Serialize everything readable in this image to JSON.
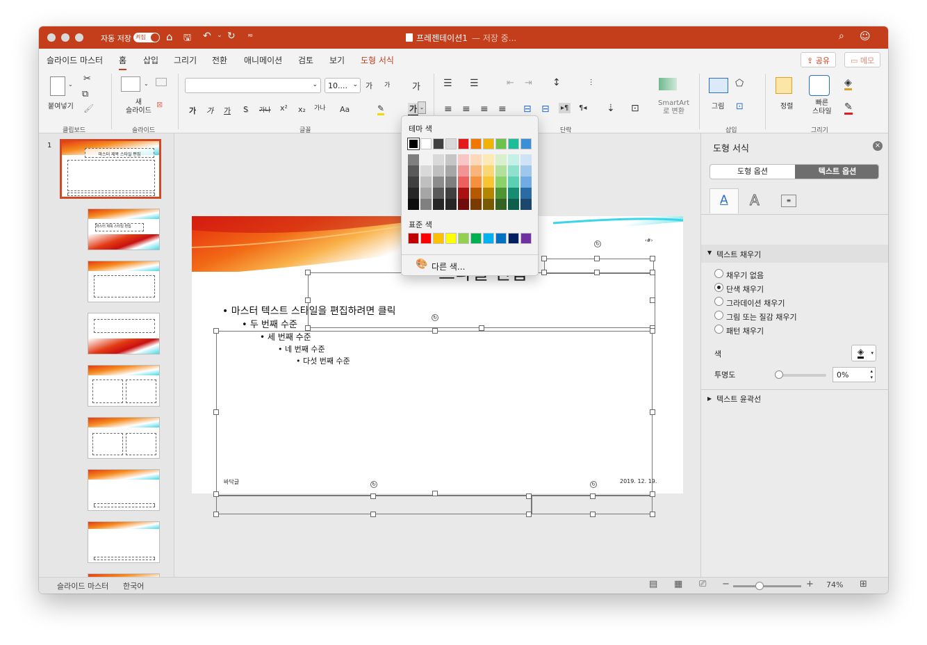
{
  "titlebar": {
    "autosave_label": "자동 저장",
    "autosave_toggle": "켜짐",
    "doc_title": "프레젠테이션1",
    "save_status": " — 저장 중..."
  },
  "tabs": [
    {
      "label": "슬라이드 마스터"
    },
    {
      "label": "홈"
    },
    {
      "label": "삽입"
    },
    {
      "label": "그리기"
    },
    {
      "label": "전환"
    },
    {
      "label": "애니메이션"
    },
    {
      "label": "검토"
    },
    {
      "label": "보기"
    },
    {
      "label": "도형 서식"
    }
  ],
  "header_buttons": {
    "share": "공유",
    "comments": "메모"
  },
  "ribbon": {
    "clipboard": {
      "paste_label": "붙여넣기",
      "group": "클립보드"
    },
    "slides": {
      "new_slide_line1": "새",
      "new_slide_line2": "슬라이드",
      "group": "슬라이드"
    },
    "font": {
      "font_name": "",
      "font_size": "10....",
      "grow": "가",
      "shrink": "가",
      "clear": "가",
      "bold": "가",
      "italic": "가",
      "underline": "가",
      "shadow": "S",
      "strike": "가나",
      "superscript": "x²",
      "subscript": "x₂",
      "spacing": "가나",
      "case": "Aa",
      "font_color": "가",
      "group": "글꼴"
    },
    "paragraph": {
      "smartart_line1": "SmartArt",
      "smartart_line2": "로 변환",
      "group": "단락"
    },
    "insert": {
      "picture": "그림",
      "group": "삽입"
    },
    "drawing": {
      "arrange": "정렬",
      "quick_styles_line1": "빠른",
      "quick_styles_line2": "스타일",
      "group": "그리기"
    }
  },
  "slide": {
    "title_visible": "스타일 편집",
    "body_levels": [
      "마스터 텍스트 스타일을 편집하려면 클릭",
      "두 번째 수준",
      "세 번째 수준",
      "네 번째 수준",
      "다섯 번째 수준"
    ],
    "footer": "바닥글",
    "date": "2019. 12. 19.",
    "page_number": "‹#›"
  },
  "thumbnails": {
    "first_number": "1",
    "first_title": "마스터 제목 스타일 편집",
    "second_title": "마스터 제목 스타일 편집"
  },
  "color_popup": {
    "theme_header": "테마 색",
    "standard_header": "표준 색",
    "more_colors": "다른 색...",
    "theme_colors": [
      "#000000",
      "#ffffff",
      "#404040",
      "#d9d9d9",
      "#e21a1a",
      "#f07700",
      "#f0b400",
      "#6cc24a",
      "#1ebd9a",
      "#3b8fd6"
    ],
    "theme_shades": [
      [
        "#7f7f7f",
        "#f2f2f2",
        "#d9d9d9",
        "#c5c5c5",
        "#f9c6c6",
        "#fcd9b8",
        "#fde9b3",
        "#d8f0cc",
        "#c5f0e6",
        "#cfe3f6"
      ],
      [
        "#595959",
        "#d9d9d9",
        "#bfbfbf",
        "#a6a6a6",
        "#f29494",
        "#f9b47a",
        "#fbd773",
        "#b1e19a",
        "#8fe0cd",
        "#9fc7ec"
      ],
      [
        "#404040",
        "#bfbfbf",
        "#8c8c8c",
        "#7f7f7f",
        "#ec6060",
        "#f6903e",
        "#f8c432",
        "#8bd268",
        "#5bd1b4",
        "#70abe2"
      ],
      [
        "#262626",
        "#a6a6a6",
        "#595959",
        "#404040",
        "#aa1212",
        "#b55800",
        "#b48600",
        "#4e9433",
        "#148d73",
        "#2a6ba3"
      ],
      [
        "#0d0d0d",
        "#808080",
        "#262626",
        "#262626",
        "#710c0c",
        "#793b00",
        "#785a00",
        "#346222",
        "#0d5e4d",
        "#1c476d"
      ]
    ],
    "standard_colors": [
      "#c00000",
      "#ff0000",
      "#ffc000",
      "#ffff00",
      "#92d050",
      "#00b050",
      "#00b0f0",
      "#0070c0",
      "#002060",
      "#7030a0"
    ]
  },
  "format_pane": {
    "title": "도형 서식",
    "tab_shape": "도형 옵션",
    "tab_text": "텍스트 옵션",
    "text_fill_section": "텍스트 채우기",
    "fill_options": [
      "채우기 없음",
      "단색 채우기",
      "그라데이션 채우기",
      "그림 또는 질감 채우기",
      "패턴 채우기"
    ],
    "selected_fill": "단색 채우기",
    "color_label": "색",
    "transparency_label": "투명도",
    "transparency_value": "0%",
    "text_outline_section": "텍스트 윤곽선"
  },
  "statusbar": {
    "view": "슬라이드 마스터",
    "language": "한국어",
    "zoom": "74%"
  }
}
